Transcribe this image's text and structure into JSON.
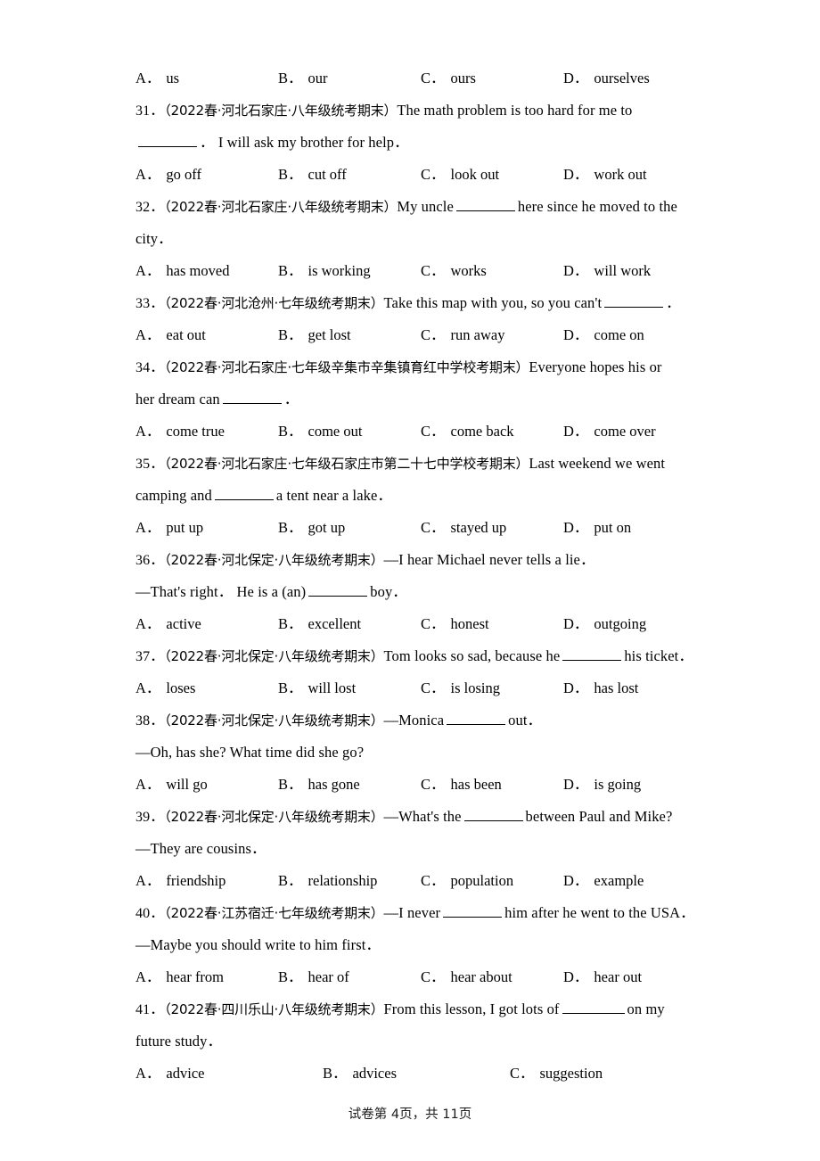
{
  "page": {
    "footer": "试卷第 4页，共 11页"
  },
  "questions": [
    {
      "id": "q30-options",
      "options_only": true,
      "options": [
        {
          "mark": "A．",
          "text": "us"
        },
        {
          "mark": "B．",
          "text": "our"
        },
        {
          "mark": "C．",
          "text": "ours"
        },
        {
          "mark": "D．",
          "text": "ourselves"
        }
      ]
    },
    {
      "id": "q31",
      "number": "31．",
      "source": "（2022春·河北石家庄·八年级统考期末）",
      "stem_lines": [
        "The math problem is too hard for me to",
        "．   I will ask my brother for help．"
      ],
      "options": [
        {
          "mark": "A．",
          "text": "go off"
        },
        {
          "mark": "B．",
          "text": "cut off"
        },
        {
          "mark": "C．",
          "text": "look out"
        },
        {
          "mark": "D．",
          "text": "work out"
        }
      ]
    },
    {
      "id": "q32",
      "number": "32．",
      "source": "（2022春·河北石家庄·八年级统考期末）",
      "stem_lines": [
        "My uncle",
        "here since he moved to the",
        "city．"
      ],
      "options": [
        {
          "mark": "A．",
          "text": "has moved"
        },
        {
          "mark": "B．",
          "text": "is working"
        },
        {
          "mark": "C．",
          "text": "works"
        },
        {
          "mark": "D．",
          "text": "will work"
        }
      ]
    },
    {
      "id": "q33",
      "number": "33．",
      "source": "（2022春·河北沧州·七年级统考期末）",
      "stem_lines": [
        "Take this map with you, so you can't",
        "．"
      ],
      "options": [
        {
          "mark": "A．",
          "text": "eat out"
        },
        {
          "mark": "B．",
          "text": "get lost"
        },
        {
          "mark": "C．",
          "text": "run away"
        },
        {
          "mark": "D．",
          "text": "come on"
        }
      ]
    },
    {
      "id": "q34",
      "number": "34．",
      "source": "（2022春·河北石家庄·七年级辛集市辛集镇育红中学校考期末）",
      "stem_lines": [
        "Everyone hopes his or",
        "her dream can",
        "．"
      ],
      "options": [
        {
          "mark": "A．",
          "text": "come true"
        },
        {
          "mark": "B．",
          "text": "come out"
        },
        {
          "mark": "C．",
          "text": "come back"
        },
        {
          "mark": "D．",
          "text": "come over"
        }
      ]
    },
    {
      "id": "q35",
      "number": "35．",
      "source": "（2022春·河北石家庄·七年级石家庄市第二十七中学校考期末）",
      "stem_lines": [
        "Last weekend we went",
        "camping and",
        "a tent near a lake．"
      ],
      "options": [
        {
          "mark": "A．",
          "text": "put up"
        },
        {
          "mark": "B．",
          "text": "got up"
        },
        {
          "mark": "C．",
          "text": "stayed up"
        },
        {
          "mark": "D．",
          "text": "put on"
        }
      ]
    },
    {
      "id": "q36",
      "number": "36．",
      "source": "（2022春·河北保定·八年级统考期末）",
      "stem_lines": [
        "—I hear Michael never tells a lie．",
        "—That's right．   He is a (an)",
        "boy．"
      ],
      "options": [
        {
          "mark": "A．",
          "text": "active"
        },
        {
          "mark": "B．",
          "text": "excellent"
        },
        {
          "mark": "C．",
          "text": "honest"
        },
        {
          "mark": "D．",
          "text": "outgoing"
        }
      ]
    },
    {
      "id": "q37",
      "number": "37．",
      "source": "（2022春·河北保定·八年级统考期末）",
      "stem_lines": [
        "Tom looks so sad, because he",
        "his ticket．"
      ],
      "options": [
        {
          "mark": "A．",
          "text": "loses"
        },
        {
          "mark": "B．",
          "text": "will lost"
        },
        {
          "mark": "C．",
          "text": "is losing"
        },
        {
          "mark": "D．",
          "text": "has lost"
        }
      ]
    },
    {
      "id": "q38",
      "number": "38．",
      "source": "（2022春·河北保定·八年级统考期末）",
      "stem_lines": [
        "—Monica",
        "out．",
        "—Oh, has she? What time did she go?"
      ],
      "options": [
        {
          "mark": "A．",
          "text": "will go"
        },
        {
          "mark": "B．",
          "text": "has gone"
        },
        {
          "mark": "C．",
          "text": "has been"
        },
        {
          "mark": "D．",
          "text": "is going"
        }
      ]
    },
    {
      "id": "q39",
      "number": "39．",
      "source": "（2022春·河北保定·八年级统考期末）",
      "stem_lines": [
        "—What's the",
        "between Paul and Mike?",
        "—They are cousins．"
      ],
      "options": [
        {
          "mark": "A．",
          "text": "friendship"
        },
        {
          "mark": "B．",
          "text": "relationship"
        },
        {
          "mark": "C．",
          "text": "population"
        },
        {
          "mark": "D．",
          "text": "example"
        }
      ]
    },
    {
      "id": "q40",
      "number": "40．",
      "source": "（2022春·江苏宿迁·七年级统考期末）",
      "stem_lines": [
        "—I never",
        "him after he went to the USA．",
        "—Maybe you should write to him first．"
      ],
      "options": [
        {
          "mark": "A．",
          "text": "hear from"
        },
        {
          "mark": "B．",
          "text": "hear of"
        },
        {
          "mark": "C．",
          "text": "hear about"
        },
        {
          "mark": "D．",
          "text": "hear out"
        }
      ]
    },
    {
      "id": "q41",
      "number": "41．",
      "source": "（2022春·四川乐山·八年级统考期末）",
      "stem_lines": [
        "From this lesson, I got lots of",
        "on my",
        "future study．"
      ],
      "options": [
        {
          "mark": "A．",
          "text": "advice"
        },
        {
          "mark": "B．",
          "text": "advices"
        },
        {
          "mark": "C．",
          "text": "suggestion"
        }
      ]
    }
  ]
}
